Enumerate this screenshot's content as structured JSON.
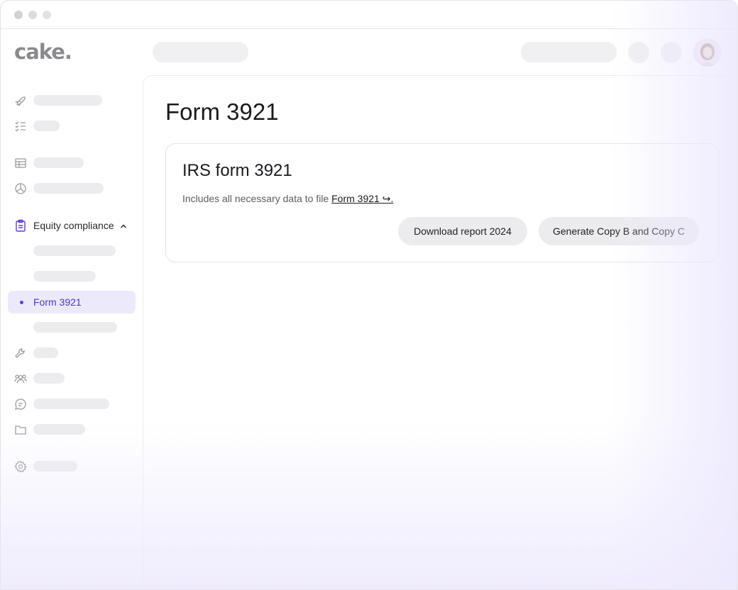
{
  "app": {
    "logo": "cake."
  },
  "sidebar": {
    "group": {
      "label": "Equity compliance",
      "expanded": true
    },
    "active_item": {
      "label": "Form 3921"
    }
  },
  "main": {
    "page_title": "Form 3921",
    "card": {
      "title": "IRS form 3921",
      "description_prefix": "Includes all necessary data to file ",
      "link_text": "Form 3921 ↪.",
      "download_button": "Download report 2024",
      "generate_button": "Generate Copy B and Copy C"
    }
  },
  "colors": {
    "accent": "#5b3fd6",
    "active_bg": "#ece9fb",
    "skeleton": "#ececee"
  }
}
